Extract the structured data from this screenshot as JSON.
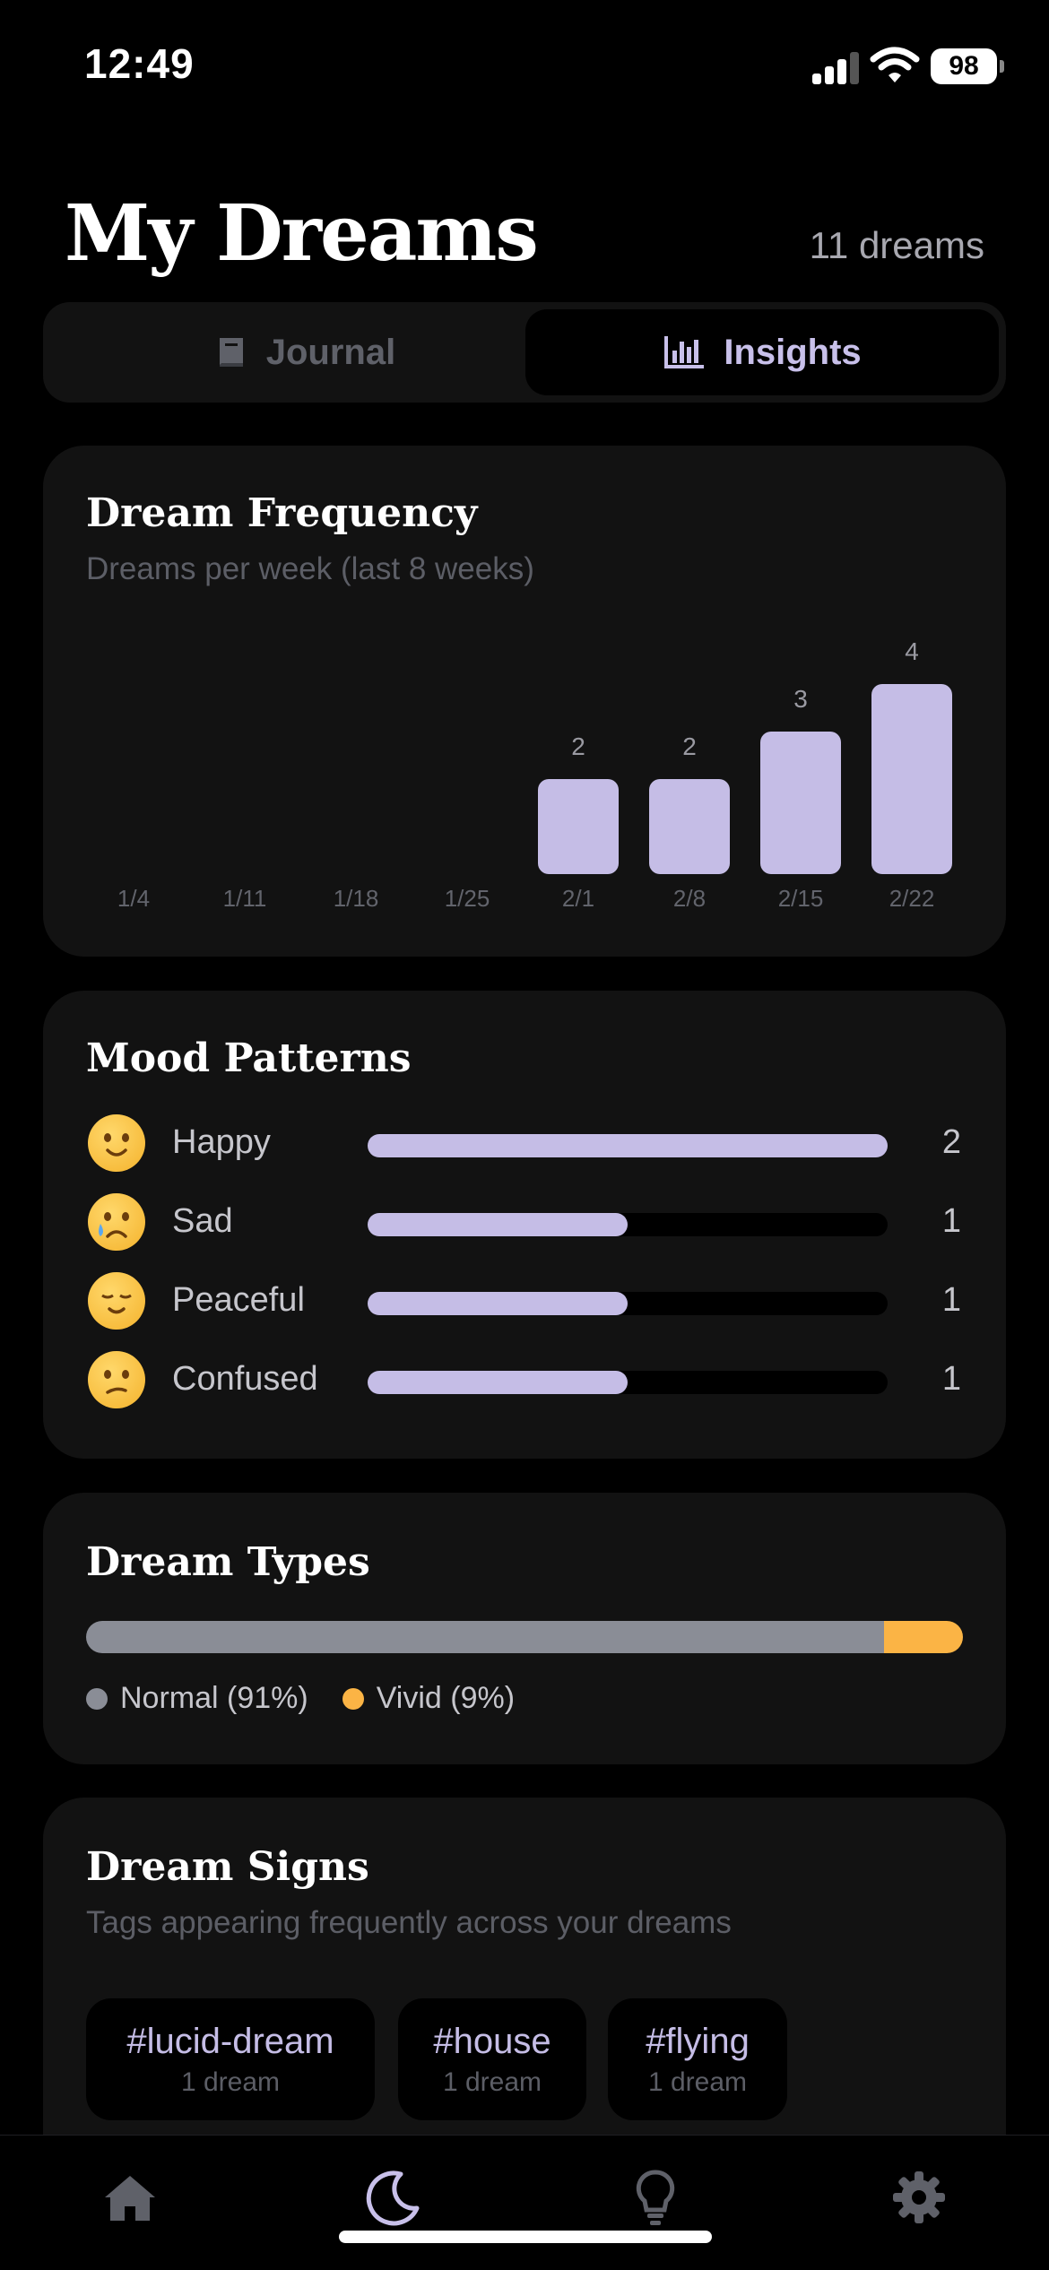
{
  "status_bar": {
    "time": "12:49",
    "battery": "98"
  },
  "header": {
    "title": "My Dreams",
    "count": "11 dreams"
  },
  "segments": {
    "journal": "Journal",
    "insights": "Insights",
    "selected": "Insights"
  },
  "frequency": {
    "title": "Dream Frequency",
    "subtitle": "Dreams per week (last 8 weeks)"
  },
  "chart_data": {
    "type": "bar",
    "title": "Dream Frequency",
    "subtitle": "Dreams per week (last 8 weeks)",
    "categories": [
      "1/4",
      "1/11",
      "1/18",
      "1/25",
      "2/1",
      "2/8",
      "2/15",
      "2/22"
    ],
    "values": [
      0,
      0,
      0,
      0,
      2,
      2,
      3,
      4
    ],
    "data_labels": [
      "",
      "",
      "",
      "",
      "2",
      "2",
      "3",
      "4"
    ],
    "xlabel": "",
    "ylabel": "",
    "ylim": [
      0,
      4
    ],
    "grid": false,
    "bar_color": "#c5bde6"
  },
  "mood": {
    "title": "Mood Patterns",
    "items": [
      {
        "emoji": "smiling-face-icon",
        "label": "Happy",
        "count": "2",
        "fraction": 1.0
      },
      {
        "emoji": "crying-face-icon",
        "label": "Sad",
        "count": "1",
        "fraction": 0.5
      },
      {
        "emoji": "relieved-face-icon",
        "label": "Peaceful",
        "count": "1",
        "fraction": 0.5
      },
      {
        "emoji": "confused-face-icon",
        "label": "Confused",
        "count": "1",
        "fraction": 0.5
      }
    ]
  },
  "types": {
    "title": "Dream Types",
    "items": [
      {
        "label": "Normal (91%)",
        "percent": 91,
        "color": "#8a8d96"
      },
      {
        "label": "Vivid (9%)",
        "percent": 9,
        "color": "#fbb445"
      }
    ]
  },
  "signs": {
    "title": "Dream Signs",
    "subtitle": "Tags appearing frequently across your dreams",
    "tags": [
      {
        "name": "#lucid-dream",
        "count": "1 dream"
      },
      {
        "name": "#house",
        "count": "1 dream"
      },
      {
        "name": "#flying",
        "count": "1 dream"
      }
    ]
  },
  "tabbar": {
    "items": [
      "home-icon",
      "moon-icon",
      "lightbulb-icon",
      "gear-icon"
    ],
    "active": "moon-icon"
  },
  "colors": {
    "accent": "#c5bde6",
    "card": "#121212",
    "background": "#000000"
  }
}
